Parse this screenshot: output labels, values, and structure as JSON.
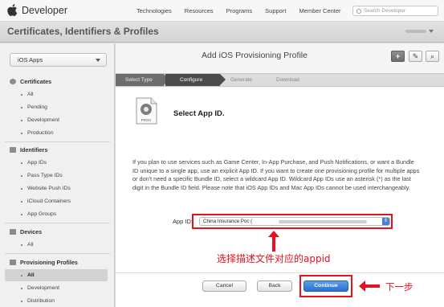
{
  "topnav": {
    "brand": "Developer",
    "links": [
      "Technologies",
      "Resources",
      "Programs",
      "Support",
      "Member Center"
    ],
    "search_placeholder": "Search Developer"
  },
  "header": {
    "title": "Certificates, Identifiers & Profiles"
  },
  "sidebar": {
    "platform": "iOS Apps",
    "sections": [
      {
        "title": "Certificates",
        "items": [
          "All",
          "Pending",
          "Development",
          "Production"
        ]
      },
      {
        "title": "Identifiers",
        "items": [
          "App IDs",
          "Pass Type IDs",
          "Website Push IDs",
          "iCloud Containers",
          "App Groups"
        ]
      },
      {
        "title": "Devices",
        "items": [
          "All"
        ]
      },
      {
        "title": "Provisioning Profiles",
        "items": [
          "All",
          "Development",
          "Distribution"
        ]
      }
    ],
    "selected": "Provisioning Profiles / All"
  },
  "main": {
    "title": "Add iOS Provisioning Profile",
    "toolbar": {
      "add": "+",
      "edit": "✎",
      "search": "⌕"
    },
    "steps": [
      "Select Type",
      "Configure",
      "Generate",
      "Download"
    ],
    "active_step": "Configure",
    "heading": "Select App ID.",
    "icon_label": "PROV",
    "description": "If you plan to use services such as Game Center, In-App Purchase, and Push Notifications, or want a Bundle ID unique to a single app, use an explicit App ID. If you want to create one provisioning profile for multiple apps or don't need a specific Bundle ID, select a wildcard App ID. Wildcard App IDs use an asterisk (*) as the last digit in the Bundle ID field. Please note that iOS App IDs and Mac App IDs cannot be used interchangeably.",
    "appid_label": "App ID:",
    "appid_value": "China Insurance Poc (",
    "buttons": {
      "cancel": "Cancel",
      "back": "Back",
      "continue": "Continue"
    }
  },
  "annotations": {
    "select_appid": "选择描述文件对应的appid",
    "next_step": "下一步",
    "color": "#e8101a"
  }
}
